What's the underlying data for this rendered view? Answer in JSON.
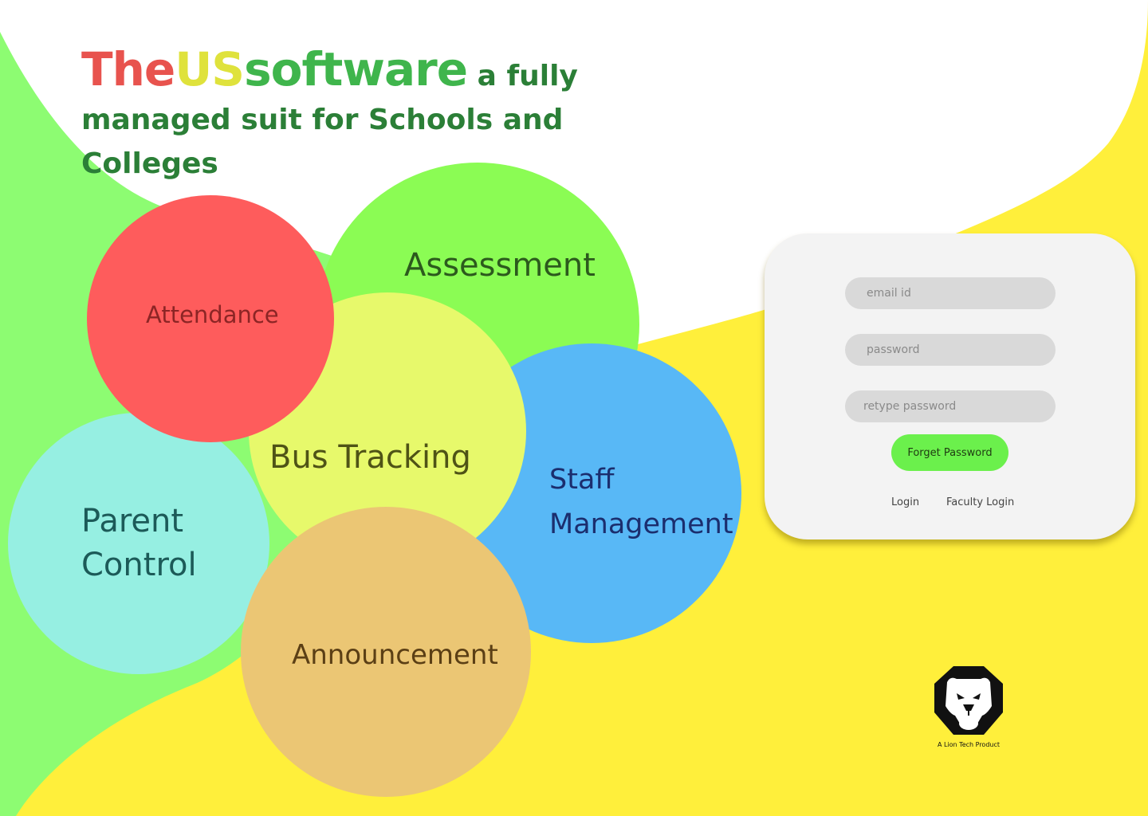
{
  "hero": {
    "brand_part1": "The",
    "brand_part2": "US",
    "brand_part3": "software",
    "tagline": " a fully managed suit for Schools and Colleges"
  },
  "features": {
    "assessment": "Assessment",
    "attendance": "Attendance",
    "bus_tracking": "Bus Tracking",
    "staff_management": "Staff Management",
    "parent_control": "Parent Control",
    "announcement": "Announcement"
  },
  "login": {
    "email_placeholder": "email id",
    "password_placeholder": "password",
    "retype_placeholder": "retype password",
    "forget_button": "Forget Password",
    "login_link": "Login",
    "faculty_login_link": "Faculty Login"
  },
  "footer": {
    "logo_icon": "lion-icon",
    "tagline": "A Lion Tech Product"
  },
  "colors": {
    "background_yellow": "#ffef3b",
    "background_green": "#8dfc72",
    "brand_red": "#e8534e",
    "brand_yellow": "#dfe23c",
    "brand_green": "#3fb54c",
    "headline_green": "#2b7f37",
    "attendance": "#fe5c5c",
    "assessment": "#8bfc54",
    "bus_tracking": "#e7f96b",
    "staff_management": "#58b8f6",
    "parent_control": "#96efe2",
    "announcement": "#ebc674",
    "card": "#f3f3f3",
    "field": "#d9d9d9",
    "forget_button": "#6bf04c"
  }
}
